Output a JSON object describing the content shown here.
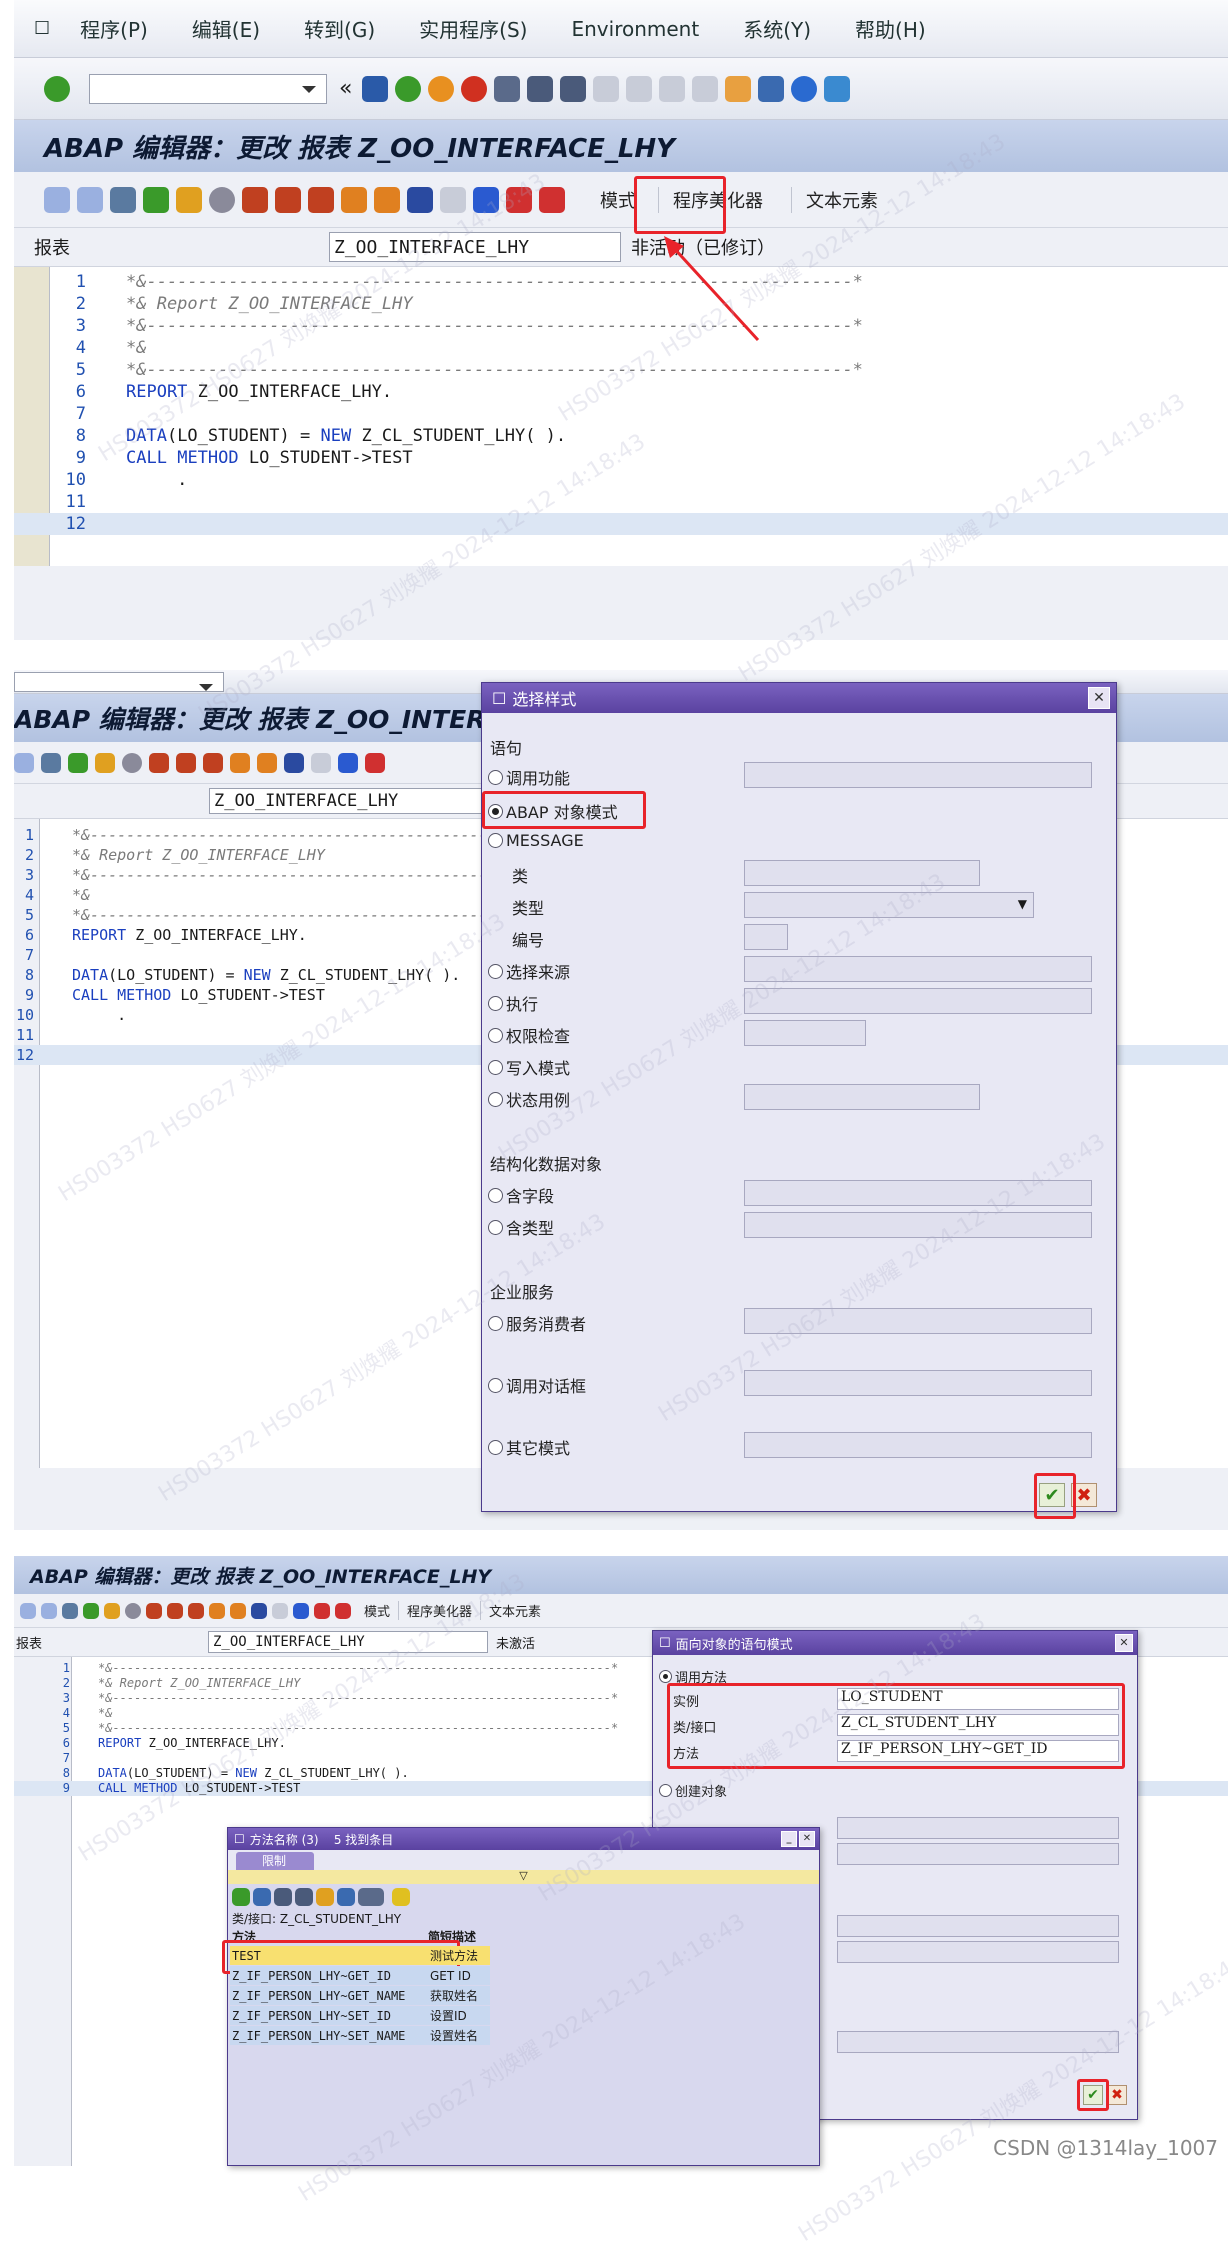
{
  "menu": [
    "程序(P)",
    "编辑(E)",
    "转到(G)",
    "实用程序(S)",
    "Environment",
    "系统(Y)",
    "帮助(H)"
  ],
  "title": "ABAP 编辑器：更改 报表 Z_OO_INTERFACE_LHY",
  "app_toolbar": {
    "pattern": "模式",
    "pretty_printer": "程序美化器",
    "text_elements": "文本元素"
  },
  "report_label": "报表",
  "report_name": "Z_OO_INTERFACE_LHY",
  "status1": "非活动（已修订）",
  "status3": "未激活",
  "code": [
    {
      "n": "1",
      "t": "*&---------------------------------------------------------------------*"
    },
    {
      "n": "2",
      "t": "*& Report Z_OO_INTERFACE_LHY"
    },
    {
      "n": "3",
      "t": "*&---------------------------------------------------------------------*"
    },
    {
      "n": "4",
      "t": "*&"
    },
    {
      "n": "5",
      "t": "*&---------------------------------------------------------------------*"
    },
    {
      "n": "6",
      "t": "REPORT Z_OO_INTERFACE_LHY."
    },
    {
      "n": "7",
      "t": ""
    },
    {
      "n": "8",
      "t": "DATA(LO_STUDENT) = NEW Z_CL_STUDENT_LHY( )."
    },
    {
      "n": "9",
      "t": "CALL METHOD LO_STUDENT->TEST"
    },
    {
      "n": "10",
      "t": "     ."
    },
    {
      "n": "11",
      "t": ""
    },
    {
      "n": "12",
      "t": ""
    }
  ],
  "dialog1": {
    "title": "选择样式",
    "sect_statement": "语句",
    "opt_call_function": "调用功能",
    "opt_abap_oo": "ABAP 对象模式",
    "opt_message": "MESSAGE",
    "lbl_class": "类",
    "lbl_type": "类型",
    "lbl_number": "编号",
    "opt_select_from": "选择来源",
    "opt_perform": "执行",
    "opt_authority": "权限检查",
    "opt_write": "写入模式",
    "opt_case": "状态用例",
    "sect_structured": "结构化数据对象",
    "opt_with_fields": "含字段",
    "opt_with_type": "含类型",
    "sect_enterprise": "企业服务",
    "opt_consumer": "服务消费者",
    "opt_call_dialog": "调用对话框",
    "opt_other": "其它模式"
  },
  "dialog2": {
    "title": "面向对象的语句模式",
    "opt_call_method": "调用方法",
    "lbl_instance": "实例",
    "val_instance": "LO_STUDENT",
    "lbl_class": "类/接口",
    "val_class": "Z_CL_STUDENT_LHY",
    "lbl_method": "方法",
    "val_method": "Z_IF_PERSON_LHY~GET_ID",
    "opt_create_object": "创建对象"
  },
  "popup": {
    "title": "方法名称 (3)    5 找到条目",
    "tab_restrict": "限制",
    "class_line": "类/接口: Z_CL_STUDENT_LHY",
    "col_method": "方法",
    "col_desc": "简短描述",
    "rows": [
      {
        "m": "TEST",
        "d": "测试方法"
      },
      {
        "m": "Z_IF_PERSON_LHY~GET_ID",
        "d": "GET ID"
      },
      {
        "m": "Z_IF_PERSON_LHY~GET_NAME",
        "d": "获取姓名"
      },
      {
        "m": "Z_IF_PERSON_LHY~SET_ID",
        "d": "设置ID"
      },
      {
        "m": "Z_IF_PERSON_LHY~SET_NAME",
        "d": "设置姓名"
      }
    ]
  },
  "watermark": "HS003372 HS0627 刘焕耀 2024-12-12 14:18:43",
  "footer": "CSDN @1314lay_1007",
  "colors": {
    "highlight": "#e8232a",
    "title_bg": "#b8c6e2",
    "dialog_title": "#5a42a0"
  }
}
